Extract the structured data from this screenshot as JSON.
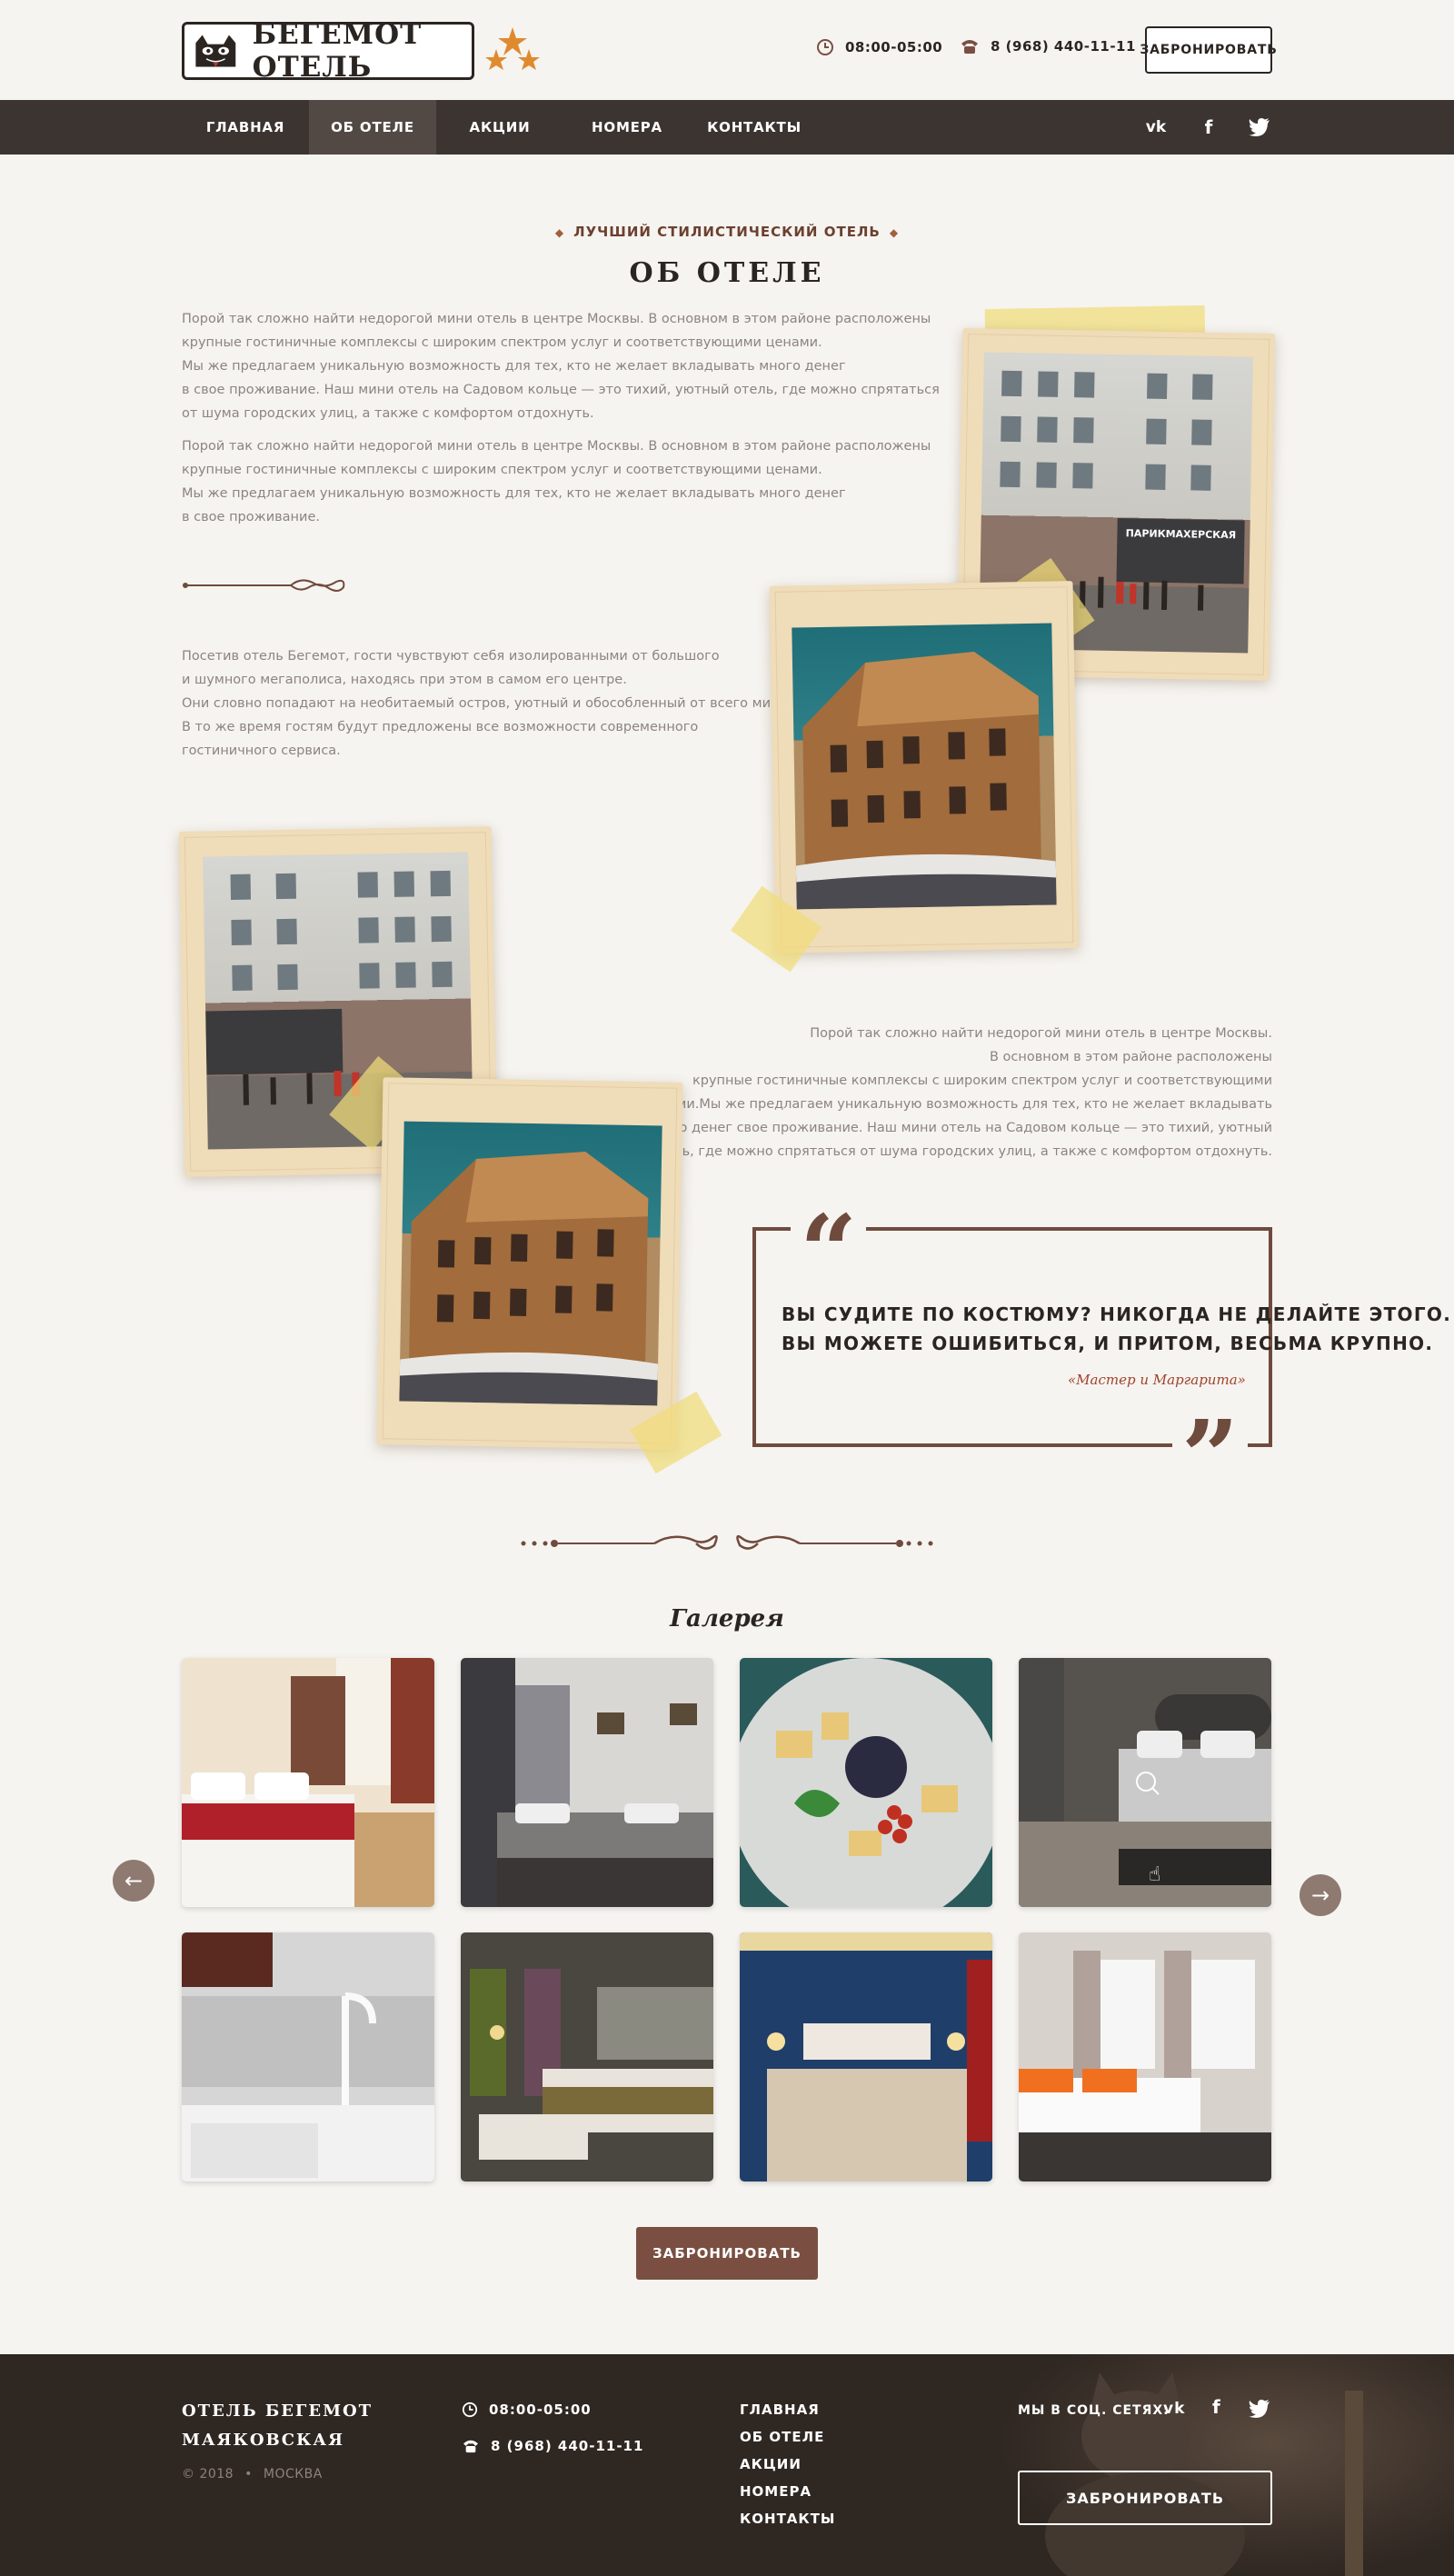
{
  "header": {
    "logo_text": "БЕГЕМОТ ОТЕЛЬ",
    "hours": "08:00-05:00",
    "phone": "8 (968) 440-11-11",
    "book_label": "ЗАБРОНИРОВАТЬ"
  },
  "nav": {
    "items": [
      {
        "label": "ГЛАВНАЯ"
      },
      {
        "label": "ОБ ОТЕЛЕ"
      },
      {
        "label": "АКЦИИ"
      },
      {
        "label": "НОМЕРА"
      },
      {
        "label": "КОНТАКТЫ"
      }
    ],
    "active": "ОБ ОТЕЛЕ",
    "social_icons": [
      "vk-icon",
      "facebook-icon",
      "twitter-icon"
    ]
  },
  "about": {
    "kicker": "ЛУЧШИЙ СТИЛИСТИЧЕСКИЙ ОТЕЛЬ",
    "title": "ОБ ОТЕЛЕ",
    "para1": [
      "Порой так сложно найти недорогой мини отель в центре Москвы. В основном в этом районе расположены",
      "крупные гостиничные комплексы с широким спектром услуг и соответствующими ценами.",
      "Мы же предлагаем уникальную возможность для тех, кто не желает вкладывать много денег",
      "в свое проживание. Наш мини отель на Садовом кольце — это тихий, уютный отель, где можно спрятаться",
      "от шума городских улиц, а также с комфортом отдохнуть."
    ],
    "para2": [
      "Порой так сложно найти недорогой мини отель в центре Москвы. В основном в этом районе расположены",
      "крупные гостиничные комплексы с широким спектром услуг и соответствующими ценами.",
      "Мы же предлагаем уникальную возможность для тех, кто не желает вкладывать много денег",
      "в свое проживание."
    ],
    "para3": [
      "Посетив отель Бегемот, гости чувствуют себя изолированными от большого",
      "и шумного мегаполиса, находясь при этом в самом его центре.",
      "Они словно попадают на необитаемый остров, уютный и обособленный от всего мира.",
      "В то же время гостям будут предложены все возможности современного",
      "гостиничного сервиса."
    ],
    "para4": [
      "Порой так сложно найти недорогой мини отель в центре Москвы.",
      "В основном в этом районе расположены",
      "крупные гостиничные комплексы с широким спектром услуг и соответствующими",
      "ценами.Мы же предлагаем уникальную возможность для тех, кто не желает вкладывать",
      "много денег свое проживание. Наш мини отель на Садовом кольце — это тихий, уютный",
      "отель, где можно спрятаться от шума городских улиц, а также с комфортом отдохнуть."
    ],
    "storefront_sign": "ПАРИКМАХЕРСКАЯ"
  },
  "quote": {
    "line1": "ВЫ СУДИТЕ ПО КОСТЮМУ? НИКОГДА НЕ ДЕЛАЙТЕ ЭТОГО.",
    "line2": "ВЫ МОЖЕТЕ ОШИБИТЬСЯ, И ПРИТОМ, ВЕСЬМА КРУПНО.",
    "source": "«Мастер и Маргарита»"
  },
  "gallery": {
    "title": "Галерея",
    "prev_icon": "arrow-left-icon",
    "next_icon": "arrow-right-icon",
    "zoom_icon": "zoom-in-icon",
    "book_label": "ЗАБРОНИРОВАТЬ"
  },
  "footer": {
    "brand_line1": "ОТЕЛЬ БЕГЕМОТ",
    "brand_line2": "МАЯКОВСКАЯ",
    "copyright": "© 2018",
    "city": "МОСКВА",
    "hours": "08:00-05:00",
    "phone": "8 (968) 440-11-11",
    "links": [
      "ГЛАВНАЯ",
      "ОБ ОТЕЛЕ",
      "АКЦИИ",
      "НОМЕРА",
      "КОНТАКТЫ"
    ],
    "social_label": "МЫ В СОЦ. СЕТЯХ:",
    "book_label": "ЗАБРОНИРОВАТЬ"
  },
  "colors": {
    "accent": "#7a4f42",
    "nav_bg": "#3b3430",
    "footer_bg": "#2f2722",
    "star": "#e08a30"
  }
}
